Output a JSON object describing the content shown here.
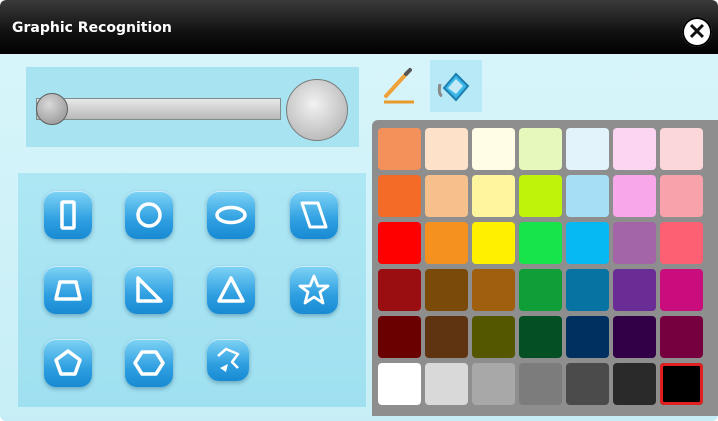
{
  "window": {
    "title": "Graphic Recognition",
    "close_icon": "close-icon"
  },
  "size_control": {
    "value": 0.0
  },
  "tools": [
    {
      "name": "pen-tool",
      "icon": "pencil-icon",
      "selected": false
    },
    {
      "name": "fill-tool",
      "icon": "paint-bucket-icon",
      "selected": true
    }
  ],
  "shapes": [
    {
      "name": "rectangle",
      "icon": "rectangle-icon"
    },
    {
      "name": "circle",
      "icon": "circle-icon"
    },
    {
      "name": "ellipse",
      "icon": "ellipse-icon"
    },
    {
      "name": "parallelogram",
      "icon": "parallelogram-icon"
    },
    {
      "name": "trapezoid",
      "icon": "trapezoid-icon"
    },
    {
      "name": "right-triangle",
      "icon": "right-triangle-icon"
    },
    {
      "name": "triangle",
      "icon": "triangle-icon"
    },
    {
      "name": "star",
      "icon": "star-icon"
    },
    {
      "name": "pentagon",
      "icon": "pentagon-icon"
    },
    {
      "name": "hexagon",
      "icon": "hexagon-icon"
    },
    {
      "name": "freeform",
      "icon": "freeform-polygon-icon"
    }
  ],
  "palette": {
    "selected_color": "#000000",
    "rows": [
      [
        "#f4905a",
        "#fde1c8",
        "#fffde5",
        "#e6f8bc",
        "#e3f3fb",
        "#fbd5f2",
        "#fcd7da"
      ],
      [
        "#f46b28",
        "#f6c08c",
        "#fff59e",
        "#bff40a",
        "#a6def6",
        "#f7a7ea",
        "#f8a2ab"
      ],
      [
        "#fe0000",
        "#f5911e",
        "#fff000",
        "#17e44a",
        "#06b9f2",
        "#a365a8",
        "#fd5f73"
      ],
      [
        "#9a0d11",
        "#7a4a09",
        "#a05f0f",
        "#0f9e37",
        "#0673a3",
        "#6a2c95",
        "#c90d7c"
      ],
      [
        "#6b0000",
        "#5f3511",
        "#555700",
        "#044f24",
        "#003060",
        "#320047",
        "#76003f"
      ],
      [
        "#ffffff",
        "#d9d9d9",
        "#a8a8a8",
        "#7c7c7c",
        "#4b4b4b",
        "#2a2a2a",
        "#000000"
      ]
    ]
  }
}
